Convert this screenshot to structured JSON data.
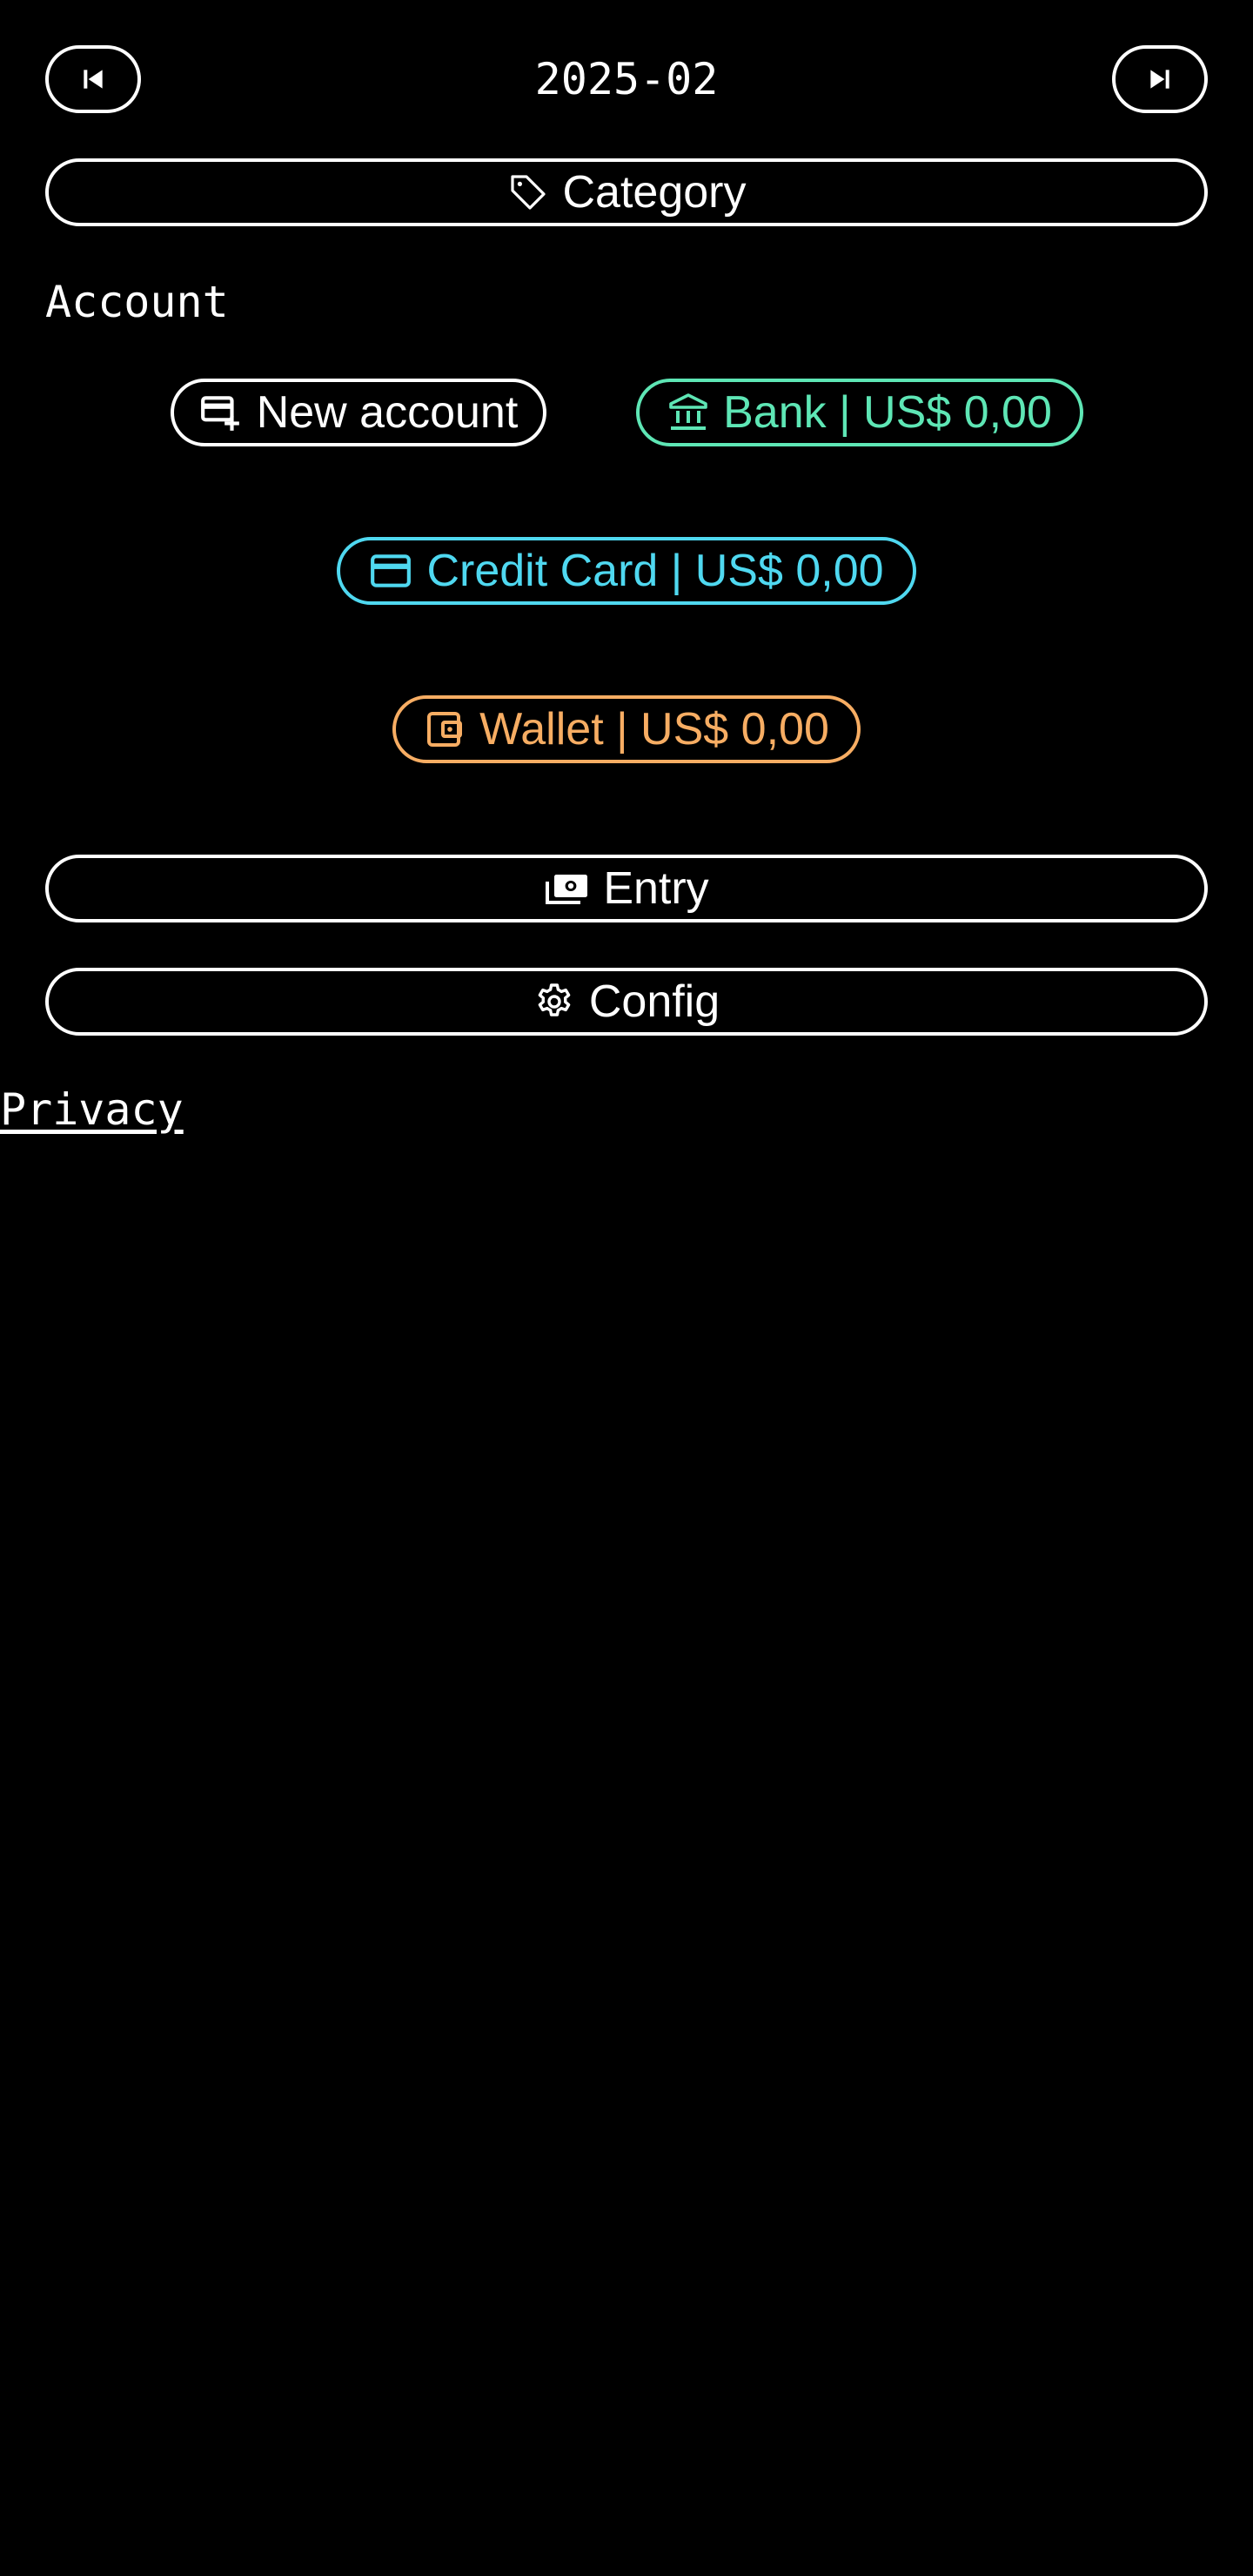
{
  "header": {
    "period": "2025-02",
    "prev_icon": "skip-previous-icon",
    "next_icon": "skip-next-icon"
  },
  "category": {
    "label": "Category",
    "icon": "tag-icon"
  },
  "accounts_section": {
    "title": "Account",
    "new_account": {
      "label": "New account",
      "icon": "card-plus-icon",
      "color": "#ffffff"
    },
    "items": [
      {
        "label": "Bank | US$ 0,00",
        "icon": "bank-icon",
        "color": "#5ee6b5"
      },
      {
        "label": "Credit Card | US$ 0,00",
        "icon": "credit-card-icon",
        "color": "#4fd8f0"
      },
      {
        "label": "Wallet | US$ 0,00",
        "icon": "wallet-icon",
        "color": "#f7ad63"
      }
    ]
  },
  "entry": {
    "label": "Entry",
    "icon": "cash-icon"
  },
  "config": {
    "label": "Config",
    "icon": "gear-icon"
  },
  "footer": {
    "privacy_link": "Privacy"
  }
}
